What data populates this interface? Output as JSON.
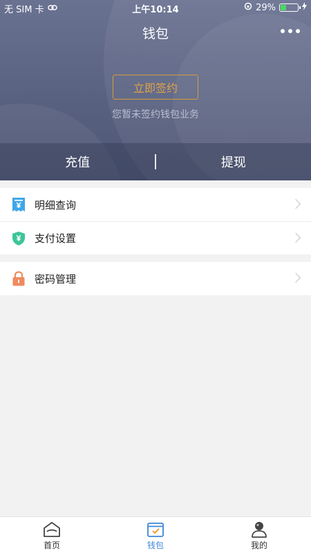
{
  "status_bar": {
    "carrier": "无 SIM 卡",
    "time": "上午10:14",
    "battery_percent_text": "29%",
    "battery_level": 0.29
  },
  "header": {
    "title": "钱包",
    "sign_button_label": "立即签约",
    "sign_hint": "您暂未签约钱包业务"
  },
  "actions": {
    "recharge_label": "充值",
    "withdraw_label": "提现"
  },
  "menu": {
    "group1": [
      {
        "label": "明细查询",
        "icon": "receipt-icon",
        "color": "#3fa7e8"
      },
      {
        "label": "支付设置",
        "icon": "shield-icon",
        "color": "#3cc59a"
      }
    ],
    "group2": [
      {
        "label": "密码管理",
        "icon": "lock-icon",
        "color": "#f08a5d"
      }
    ]
  },
  "tabbar": {
    "tabs": [
      {
        "label": "首页",
        "icon": "home-icon",
        "active": false
      },
      {
        "label": "钱包",
        "icon": "wallet-icon",
        "active": true
      },
      {
        "label": "我的",
        "icon": "user-icon",
        "active": false
      }
    ]
  },
  "colors": {
    "accent": "#3f86d8",
    "sign_button": "#e0a24a",
    "header_bg": "#5e6686"
  }
}
